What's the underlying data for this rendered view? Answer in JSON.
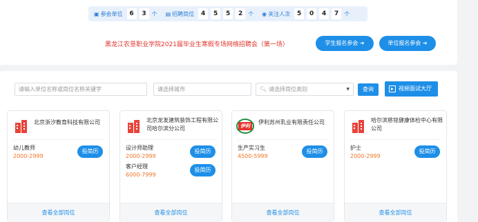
{
  "stats": [
    {
      "icon": "building-icon",
      "label": "参会单位",
      "digits": [
        "6",
        "3"
      ],
      "unit": "个"
    },
    {
      "icon": "briefcase-icon",
      "label": "招聘岗位",
      "digits": [
        "4",
        "5",
        "5",
        "2"
      ],
      "unit": "个"
    },
    {
      "icon": "eye-icon",
      "label": "关注人次",
      "digits": [
        "5",
        "0",
        "4",
        "7"
      ],
      "unit": "个"
    }
  ],
  "header": {
    "title": "黑龙江农垦职业学院2021届毕业生寒假专场网络招聘会（第一场）",
    "student_button": "学生报名参会 ➜",
    "unit_button": "单位报名参会 ➜"
  },
  "search": {
    "keyword_placeholder": "请输入单位名称或岗位名称关键字",
    "city_placeholder": "请选择城市",
    "category_placeholder": "请选择岗位类别",
    "query_button": "查询",
    "video_button": "视频面试大厅"
  },
  "colors": {
    "accent": "#1e8fe8",
    "salary": "#f07424",
    "title": "#e0322b"
  },
  "cards": [
    {
      "company": "北京浙汐教育科技有限公司",
      "logo": "building-logo-icon",
      "jobs": [
        {
          "title": "幼儿教师",
          "salary": "2000-2999",
          "apply": "投简历"
        }
      ],
      "more": "查看全部岗位"
    },
    {
      "company": "北京龙发建筑装饰工程有限公司哈尔滨分公司",
      "logo": "building-logo-icon",
      "jobs": [
        {
          "title": "设计师助理",
          "salary": "2000-2999",
          "apply": "投简历"
        },
        {
          "title": "客户经理",
          "salary": "6000-7999",
          "apply": "投简历"
        }
      ],
      "more": "查看全部岗位"
    },
    {
      "company": "伊利苏州乳业有限责任公司",
      "logo": "yili-logo",
      "logo_text": "伊利",
      "jobs": [
        {
          "title": "生产实习生",
          "salary": "4500-5999",
          "apply": "投简历"
        }
      ],
      "more": "查看全部岗位"
    },
    {
      "company": "哈尔滨慈铭健康体检中心有限公司",
      "logo": "building-logo-icon",
      "jobs": [
        {
          "title": "护士",
          "salary": "2000-2999",
          "apply": "投简历"
        }
      ],
      "more": "查看全部岗位"
    }
  ]
}
